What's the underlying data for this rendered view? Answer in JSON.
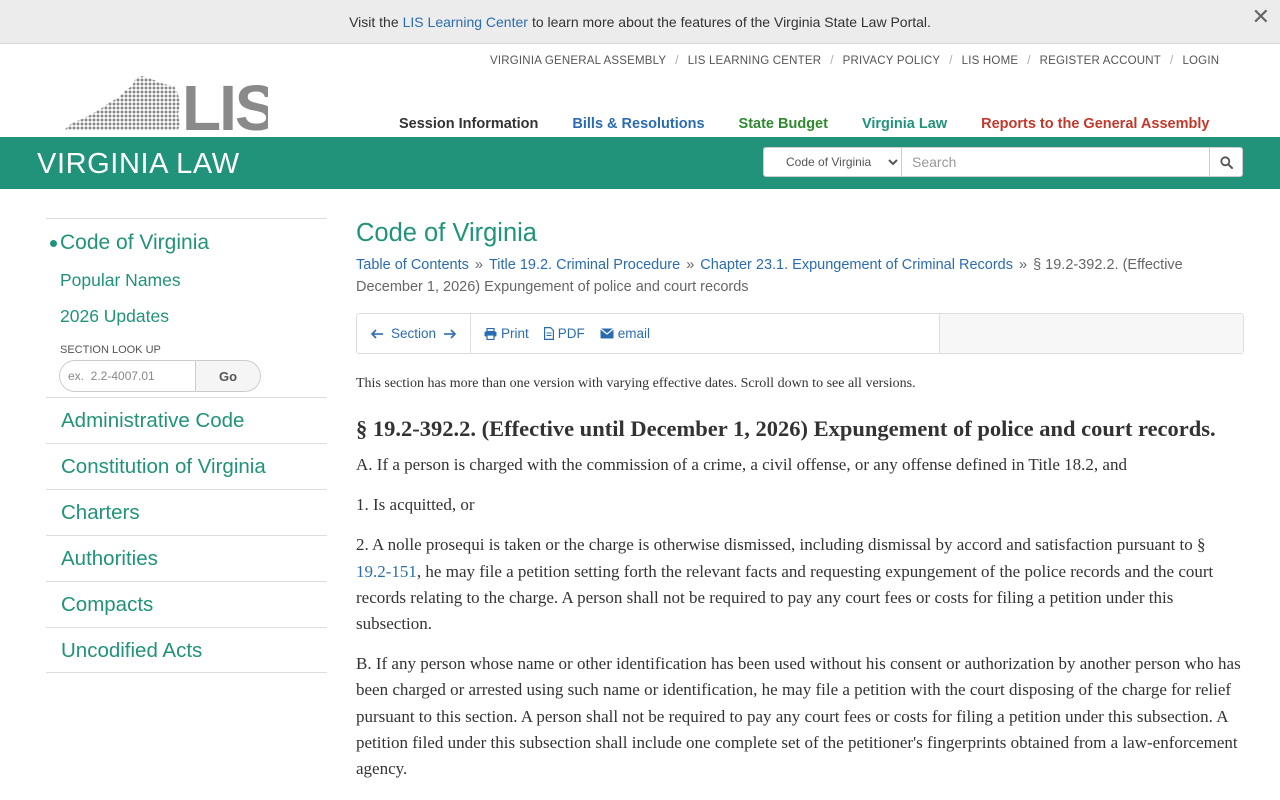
{
  "notice": {
    "prefix": "Visit the",
    "link": "LIS Learning Center",
    "suffix": "to learn more about the features of the Virginia State Law Portal.",
    "close": "✕"
  },
  "utility_links": [
    "VIRGINIA GENERAL ASSEMBLY",
    "LIS LEARNING CENTER",
    "PRIVACY POLICY",
    "LIS HOME",
    "REGISTER ACCOUNT",
    "LOGIN"
  ],
  "logo_text": "LIS",
  "main_nav": [
    {
      "label": "Session Information",
      "color": "#333333"
    },
    {
      "label": "Bills & Resolutions",
      "color": "#2b6cb0"
    },
    {
      "label": "State Budget",
      "color": "#2f8a2f"
    },
    {
      "label": "Virginia Law",
      "color": "#20937a"
    },
    {
      "label": "Reports to the General Assembly",
      "color": "#c0392b"
    }
  ],
  "header": {
    "title": "VIRGINIA LAW",
    "search_scope": "Code of Virginia",
    "search_placeholder": "Search"
  },
  "sidebar": {
    "active": "Code of Virginia",
    "sub_items": [
      "Popular Names",
      "2026 Updates"
    ],
    "lookup_label": "SECTION LOOK UP",
    "lookup_placeholder": "ex.  2.2-4007.01",
    "lookup_button": "Go",
    "items": [
      "Administrative Code",
      "Constitution of Virginia",
      "Charters",
      "Authorities",
      "Compacts",
      "Uncodified Acts"
    ]
  },
  "content": {
    "title": "Code of Virginia",
    "breadcrumbs": [
      "Table of Contents",
      "Title 19.2. Criminal Procedure",
      "Chapter 23.1. Expungement of Criminal Records"
    ],
    "breadcrumb_current": "§ 19.2-392.2. (Effective December 1, 2026) Expungement of police and court records",
    "toolbar": {
      "section_label": "Section",
      "print": "Print",
      "pdf": "PDF",
      "email": "email"
    },
    "versions_note": "This section has more than one version with varying effective dates. Scroll down to see all versions.",
    "section_title": "§ 19.2-392.2. (Effective until December 1, 2026) Expungement of police and court records.",
    "para_a": "A. If a person is charged with the commission of a crime, a civil offense, or any offense defined in Title 18.2, and",
    "para_1": "1. Is acquitted, or",
    "para_2_start": "2. A nolle prosequi is taken or the charge is otherwise dismissed, including dismissal by accord and satisfaction pursuant to §",
    "para_2_link": "19.2-151",
    "para_2_end": ", he may file a petition setting forth the relevant facts and requesting expungement of the police records and the court records relating to the charge. A person shall not be required to pay any court fees or costs for filing a petition under this subsection.",
    "para_b": "B. If any person whose name or other identification has been used without his consent or authorization by another person who has been charged or arrested using such name or identification, he may file a petition with the court disposing of the charge for relief pursuant to this section. A person shall not be required to pay any court fees or costs for filing a petition under this subsection. A petition filed under this subsection shall include one complete set of the petitioner's fingerprints obtained from a law-enforcement agency."
  },
  "colors": {
    "brand_green": "#20937a",
    "link_blue": "#2b6cb0"
  }
}
